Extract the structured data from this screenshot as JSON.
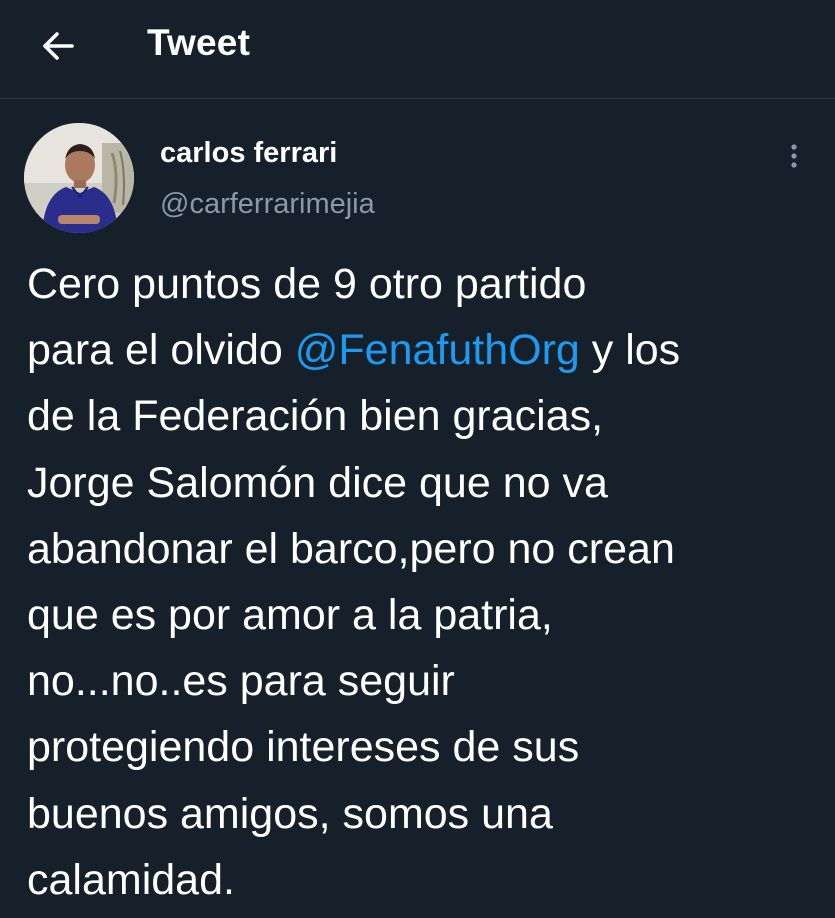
{
  "header": {
    "title": "Tweet",
    "back_icon": "arrow-left-icon"
  },
  "author": {
    "display_name": "carlos ferrari",
    "handle": "@carferrarimejia",
    "more_icon": "more-vertical-icon"
  },
  "tweet": {
    "lines": [
      "Cero puntos de 9 otro partido",
      "para el olvido ",
      " y los",
      "de la Federación bien gracias,",
      "Jorge Salomón dice que no va",
      "abandonar el barco,pero no crean",
      "que es por amor a la patria,",
      "no...no..es para seguir",
      "protegiendo intereses de sus",
      "buenos amigos, somos una",
      "calamidad."
    ],
    "mention": "@FenafuthOrg"
  },
  "colors": {
    "background": "#15202b",
    "text": "#ffffff",
    "secondary_text": "#8b98a5",
    "link": "#1d9bf0",
    "divider": "#2f3a45"
  }
}
